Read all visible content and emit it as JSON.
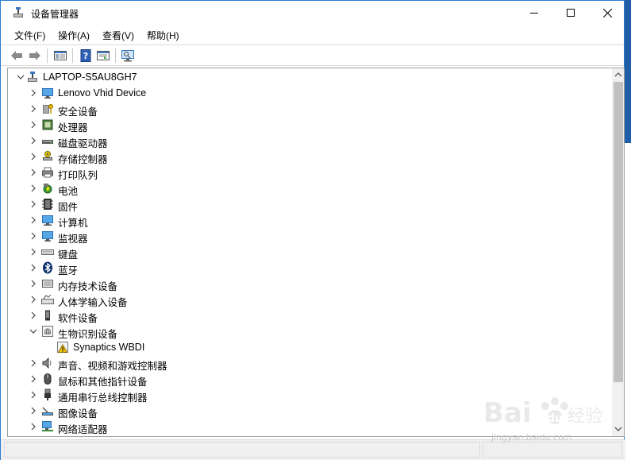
{
  "window": {
    "title": "设备管理器"
  },
  "menu": {
    "file": "文件(F)",
    "action": "操作(A)",
    "view": "查看(V)",
    "help": "帮助(H)"
  },
  "tree": {
    "root": "LAPTOP-S5AU8GH7",
    "items": [
      {
        "label": "Lenovo Vhid Device",
        "icon": "monitor-icon"
      },
      {
        "label": "安全设备",
        "icon": "security-key-icon"
      },
      {
        "label": "处理器",
        "icon": "processor-icon"
      },
      {
        "label": "磁盘驱动器",
        "icon": "disk-drive-icon"
      },
      {
        "label": "存储控制器",
        "icon": "storage-controller-icon"
      },
      {
        "label": "打印队列",
        "icon": "printer-icon"
      },
      {
        "label": "电池",
        "icon": "battery-icon"
      },
      {
        "label": "固件",
        "icon": "firmware-icon"
      },
      {
        "label": "计算机",
        "icon": "computer-icon"
      },
      {
        "label": "监视器",
        "icon": "monitor-icon"
      },
      {
        "label": "键盘",
        "icon": "keyboard-icon"
      },
      {
        "label": "蓝牙",
        "icon": "bluetooth-icon"
      },
      {
        "label": "内存技术设备",
        "icon": "memory-icon"
      },
      {
        "label": "人体学输入设备",
        "icon": "hid-icon"
      },
      {
        "label": "软件设备",
        "icon": "software-device-icon"
      },
      {
        "label": "生物识别设备",
        "icon": "fingerprint-icon",
        "expanded": true
      },
      {
        "label": "声音、视频和游戏控制器",
        "icon": "speaker-icon"
      },
      {
        "label": "鼠标和其他指针设备",
        "icon": "mouse-icon"
      },
      {
        "label": "通用串行总线控制器",
        "icon": "usb-icon"
      },
      {
        "label": "图像设备",
        "icon": "camera-icon"
      },
      {
        "label": "网络适配器",
        "icon": "network-icon"
      }
    ],
    "child": {
      "label": "Synaptics WBDI",
      "icon": "warning-icon"
    }
  },
  "watermark": {
    "url": "jingyan.baidu.com"
  }
}
